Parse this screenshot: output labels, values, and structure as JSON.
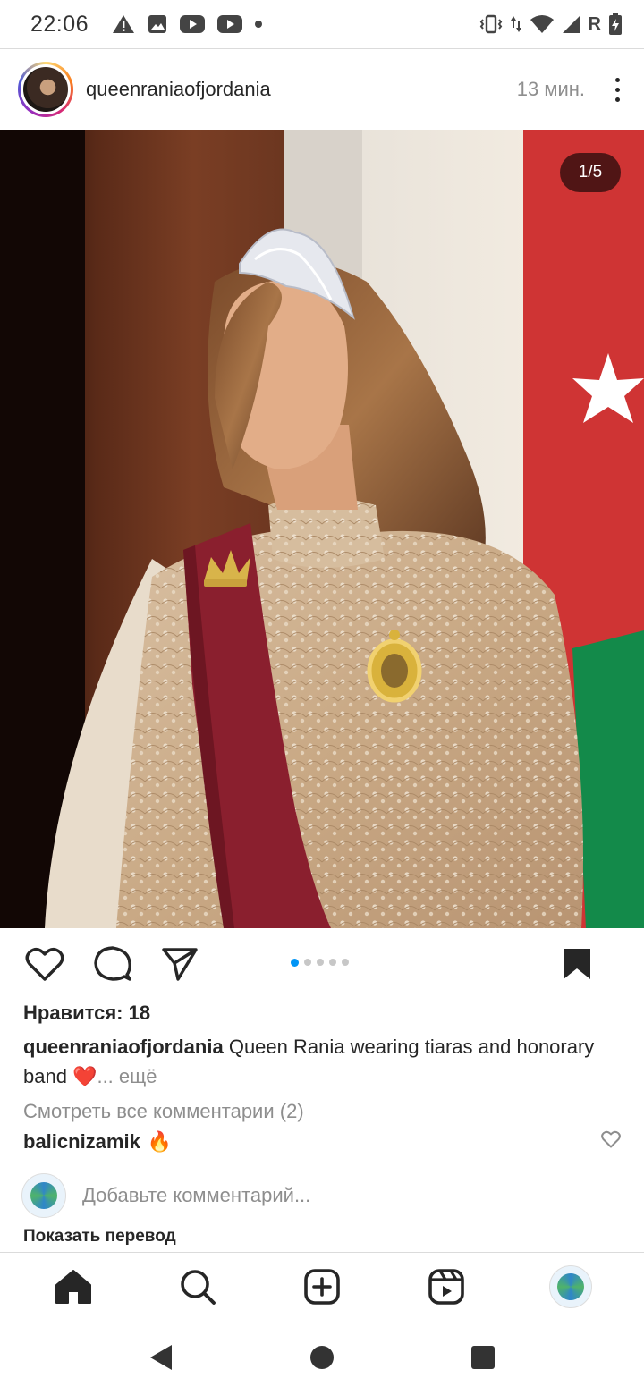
{
  "status_bar": {
    "time": "22:06",
    "left_icons": [
      "warning-icon",
      "image-icon",
      "youtube-icon",
      "youtube-icon",
      "dot-icon"
    ],
    "right_icons": [
      "vibrate-icon",
      "data-arrows-icon",
      "wifi-icon",
      "signal-icon",
      "roaming-r-icon",
      "battery-charging-icon"
    ],
    "roaming_label": "R"
  },
  "post": {
    "username": "queenraniaofjordania",
    "time_ago": "13 мин.",
    "photo_description_icon": "photo",
    "page_indicator": "1/5",
    "carousel": {
      "total": 5,
      "active": 1
    },
    "likes": "Нравится: 18",
    "caption_user": "queenraniaofjordania",
    "caption_text": " Queen Rania wearing tiaras and honorary band ❤️",
    "caption_more": "... ещё",
    "view_comments": "Смотреть все комментарии (2)",
    "comment": {
      "user": "balicnizamik",
      "text": "🔥"
    },
    "add_comment_placeholder": "Добавьте комментарий...",
    "show_translation": "Показать перевод"
  },
  "bottom_nav": {
    "items": [
      "home-icon",
      "search-icon",
      "create-icon",
      "reels-icon",
      "profile-avatar"
    ]
  },
  "system_nav": {
    "items": [
      "back-icon",
      "home-circle-icon",
      "recents-icon"
    ]
  },
  "colors": {
    "accent": "#0095f6",
    "text": "#262626",
    "secondary_text": "#8e8e8e",
    "divider": "#dbdbdb",
    "heart_red": "#e0245e"
  }
}
